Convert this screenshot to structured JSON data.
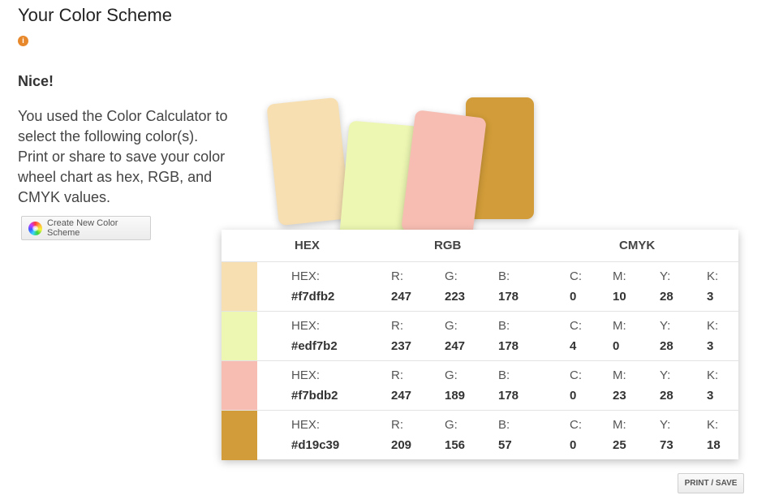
{
  "page": {
    "title": "Your Color Scheme",
    "info_icon": "i",
    "heading": "Nice!",
    "description": "You used the Color Calculator to select the following color(s). Print or share to save your color wheel chart as hex, RGB, and CMYK values."
  },
  "buttons": {
    "create_new": "Create New Color Scheme",
    "print_save": "PRINT / SAVE"
  },
  "icons": {
    "info": "info-icon",
    "color_wheel": "color-wheel-icon"
  },
  "table": {
    "headers": {
      "hex": "HEX",
      "rgb": "RGB",
      "cmyk": "CMYK"
    },
    "labels": {
      "hex": "HEX:",
      "r": "R:",
      "g": "G:",
      "b": "B:",
      "c": "C:",
      "m": "M:",
      "y": "Y:",
      "k": "K:"
    },
    "colors": [
      {
        "hex": "#f7dfb2",
        "r": "247",
        "g": "223",
        "b": "178",
        "c": "0",
        "m": "10",
        "y": "28",
        "k": "3"
      },
      {
        "hex": "#edf7b2",
        "r": "237",
        "g": "247",
        "b": "178",
        "c": "4",
        "m": "0",
        "y": "28",
        "k": "3"
      },
      {
        "hex": "#f7bdb2",
        "r": "247",
        "g": "189",
        "b": "178",
        "c": "0",
        "m": "23",
        "y": "28",
        "k": "3"
      },
      {
        "hex": "#d19c39",
        "r": "209",
        "g": "156",
        "b": "57",
        "c": "0",
        "m": "25",
        "y": "73",
        "k": "18"
      }
    ]
  }
}
